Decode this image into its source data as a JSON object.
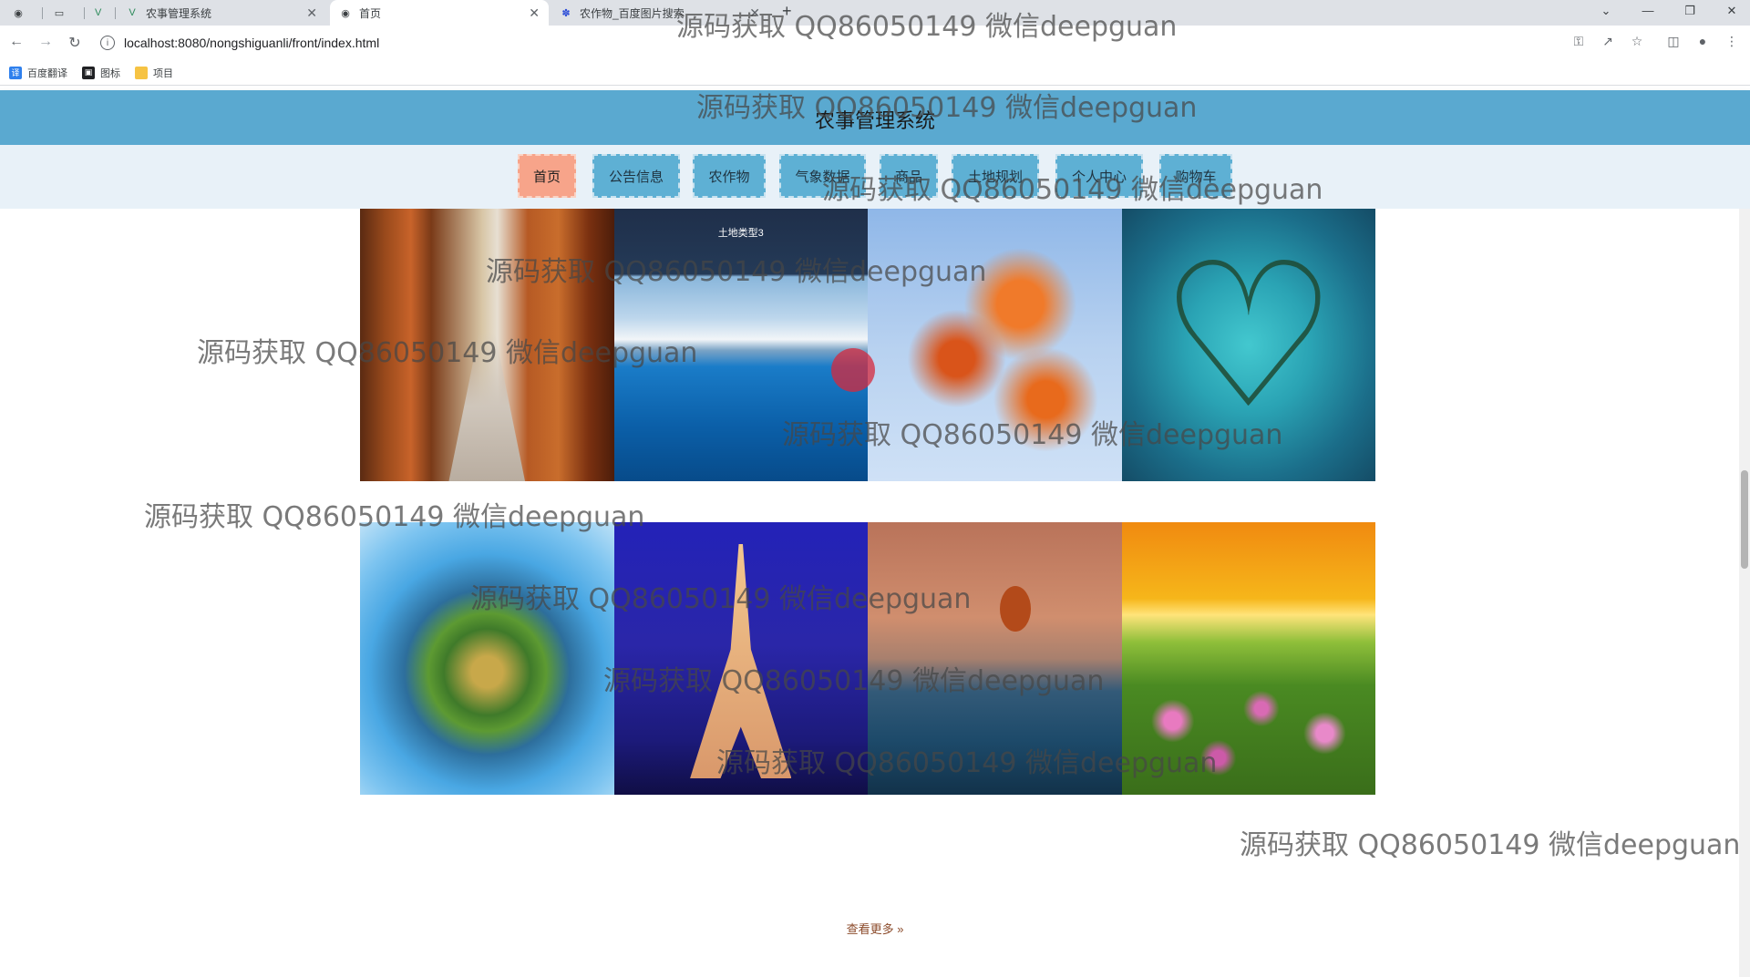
{
  "browser": {
    "tabs": [
      {
        "label": "",
        "icon": "globe-icon"
      },
      {
        "label": "",
        "icon": "blank-icon"
      },
      {
        "label": "",
        "icon": "vue-icon"
      },
      {
        "label": "农事管理系统",
        "icon": "vue-icon"
      },
      {
        "label": "首页",
        "icon": "globe-icon",
        "active": true
      },
      {
        "label": "农作物_百度图片搜索",
        "icon": "baidu-icon"
      }
    ],
    "url": "localhost:8080/nongshiguanli/front/index.html",
    "bookmarks": [
      "百度翻译",
      "图标",
      "项目"
    ]
  },
  "site": {
    "title": "农事管理系统",
    "nav": [
      "首页",
      "公告信息",
      "农作物",
      "气象数据",
      "商品",
      "土地规划",
      "个人中心",
      "购物车"
    ],
    "active_nav": "首页"
  },
  "cards": [
    {
      "label": "",
      "image": "corridor"
    },
    {
      "label": "土地类型3",
      "image": "lake"
    },
    {
      "label": "",
      "image": "leaves"
    },
    {
      "label": "",
      "image": "heart-island"
    },
    {
      "label": "",
      "image": "planet"
    },
    {
      "label": "",
      "image": "eiffel"
    },
    {
      "label": "",
      "image": "moon"
    },
    {
      "label": "",
      "image": "sunset"
    }
  ],
  "more_label": "查看更多",
  "watermark": "源码获取 QQ86050149 微信deepguan"
}
